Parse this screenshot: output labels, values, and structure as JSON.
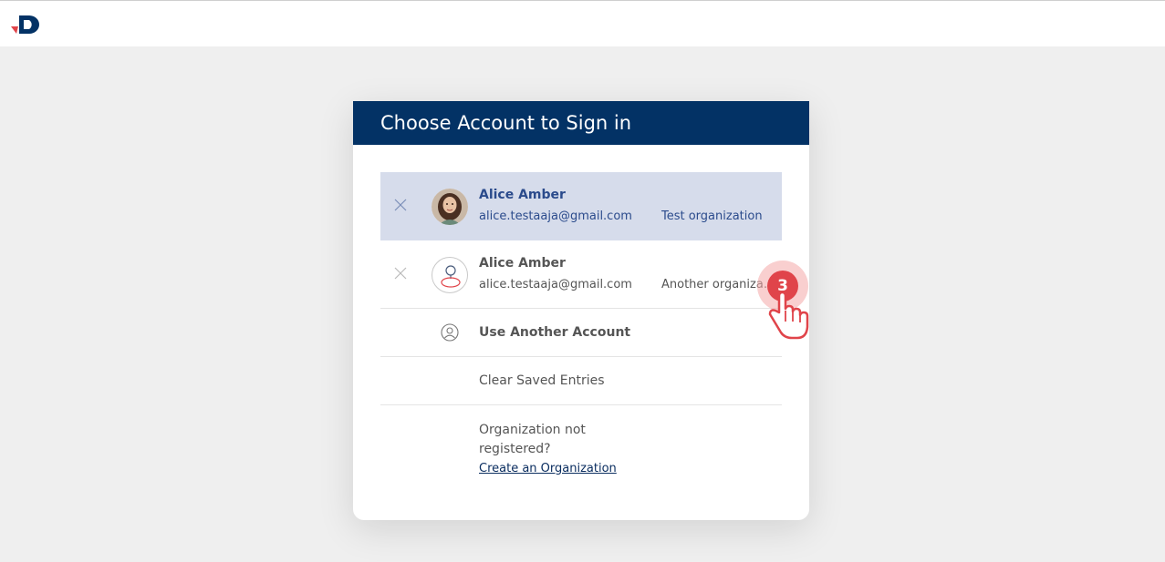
{
  "brand": {
    "logo_icon": "company-logo-icon"
  },
  "dialog": {
    "title": "Choose Account to Sign in"
  },
  "accounts": [
    {
      "name": "Alice Amber",
      "email": "alice.testaaja@gmail.com",
      "organization": "Test organization",
      "selected": true,
      "avatar": "photo-avatar"
    },
    {
      "name": "Alice Amber",
      "email": "alice.testaaja@gmail.com",
      "organization": "Another organization",
      "selected": false,
      "avatar": "user-placeholder-icon"
    }
  ],
  "actions": {
    "use_another": "Use Another Account",
    "clear_saved": "Clear Saved Entries"
  },
  "organization_prompt": {
    "text": "Organization not registered?",
    "link": "Create an Organization"
  },
  "tutorial": {
    "step": "3"
  },
  "colors": {
    "header": "#033265",
    "selected_row": "#d6dceb",
    "accent_red": "#e0444a",
    "link": "#0b2e60"
  }
}
